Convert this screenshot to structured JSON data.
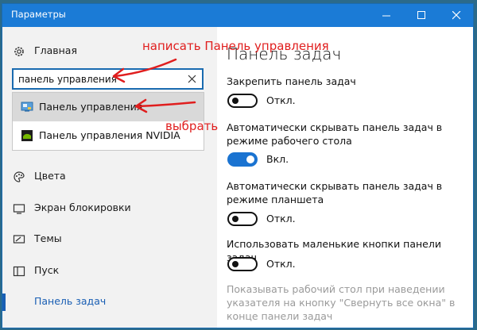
{
  "window": {
    "title": "Параметры"
  },
  "sidebar": {
    "home_label": "Главная",
    "items": [
      {
        "label": "Цвета"
      },
      {
        "label": "Экран блокировки"
      },
      {
        "label": "Темы"
      },
      {
        "label": "Пуск"
      },
      {
        "label": "Панель задач"
      }
    ]
  },
  "search": {
    "value": "панель управления",
    "results": [
      {
        "label": "Панель управления"
      },
      {
        "label": "Панель управления NVIDIA"
      }
    ]
  },
  "content": {
    "heading": "Панель задач",
    "settings": [
      {
        "label": "Закрепить панель задач",
        "state": "Откл.",
        "on": false
      },
      {
        "label": "Автоматически скрывать панель задач в режиме рабочего стола",
        "state": "Вкл.",
        "on": true
      },
      {
        "label": "Автоматически скрывать панель задач в режиме планшета",
        "state": "Откл.",
        "on": false
      },
      {
        "label": "Использовать маленькие кнопки панели задач",
        "state": "Откл.",
        "on": false
      }
    ],
    "disabled_label": "Показывать рабочий стол при наведении указателя на кнопку \"Свернуть все окна\" в конце панели задач"
  },
  "annotations": {
    "write": "написать Панель управления",
    "choose": "выбрать",
    "color": "#e01e1e"
  },
  "colors": {
    "accent": "#1b7bd6",
    "toggle_on": "#1a73d1"
  }
}
